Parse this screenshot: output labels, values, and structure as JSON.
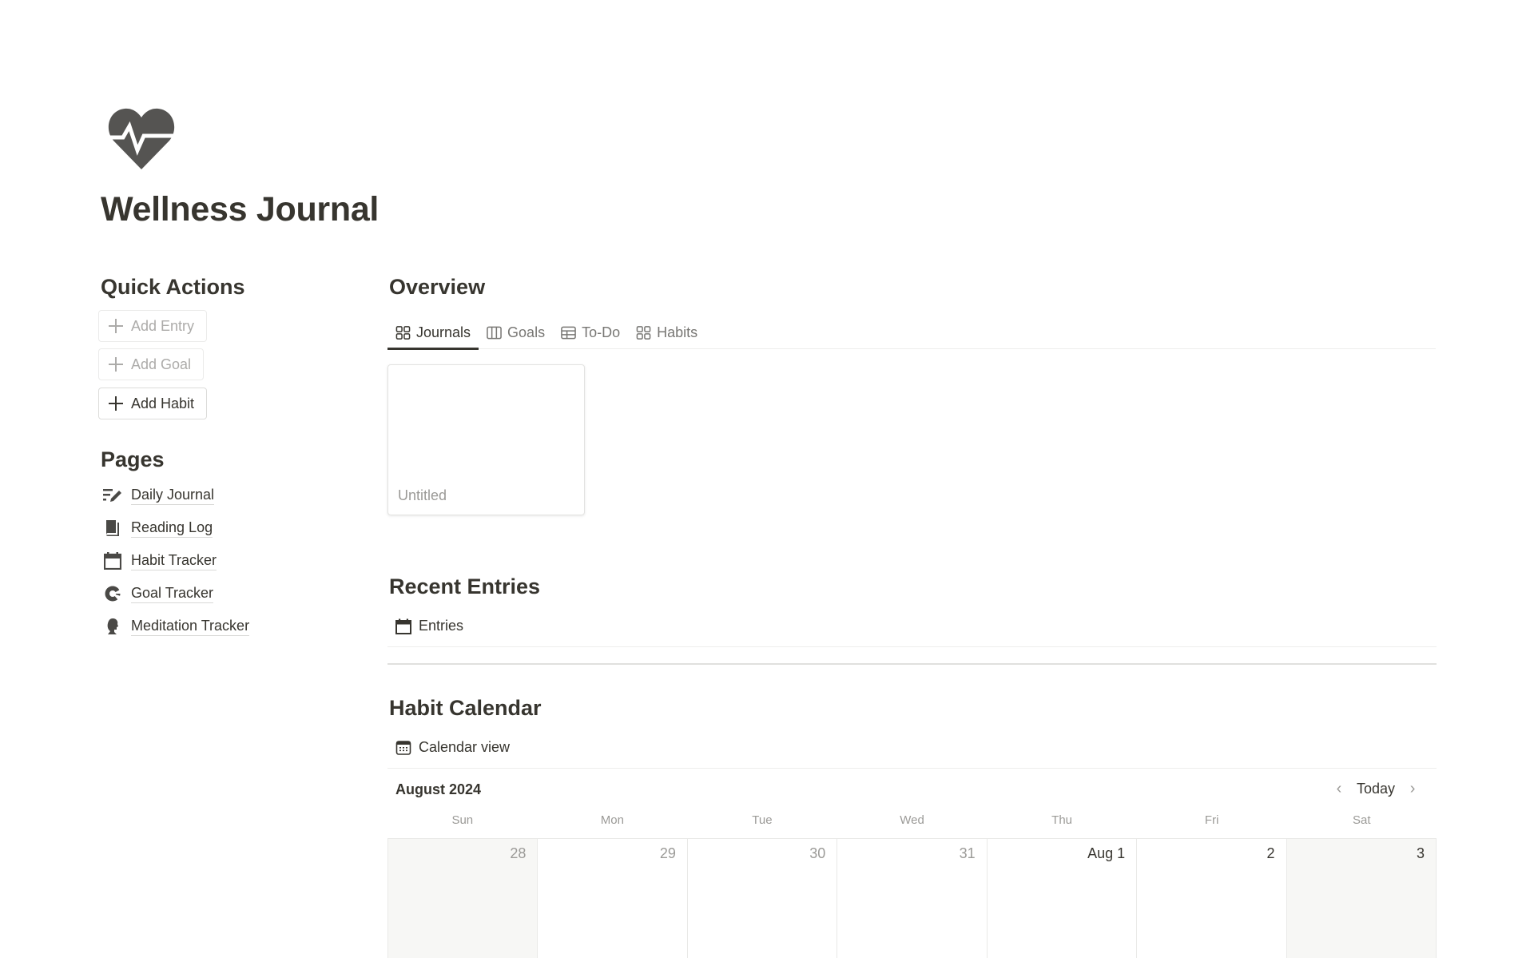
{
  "page": {
    "icon": "heart-pulse-icon",
    "title": "Wellness Journal"
  },
  "quick_actions": {
    "heading": "Quick Actions",
    "buttons": [
      {
        "label": "Add Entry",
        "icon": "plus-icon",
        "state": "muted"
      },
      {
        "label": "Add Goal",
        "icon": "plus-icon",
        "state": "muted"
      },
      {
        "label": "Add Habit",
        "icon": "plus-icon",
        "state": "active"
      }
    ]
  },
  "pages": {
    "heading": "Pages",
    "items": [
      {
        "label": "Daily Journal",
        "icon": "edit-list-icon"
      },
      {
        "label": "Reading Log",
        "icon": "book-icon"
      },
      {
        "label": "Habit Tracker",
        "icon": "calendar-icon"
      },
      {
        "label": "Goal Tracker",
        "icon": "pie-chart-icon"
      },
      {
        "label": "Meditation Tracker",
        "icon": "head-silhouette-icon"
      }
    ]
  },
  "overview": {
    "heading": "Overview",
    "tabs": [
      {
        "label": "Journals",
        "icon": "gallery-icon",
        "active": true
      },
      {
        "label": "Goals",
        "icon": "board-icon",
        "active": false
      },
      {
        "label": "To-Do",
        "icon": "table-icon",
        "active": false
      },
      {
        "label": "Habits",
        "icon": "gallery-icon",
        "active": false
      }
    ],
    "cards": [
      {
        "title": "Untitled"
      }
    ]
  },
  "recent_entries": {
    "heading": "Recent Entries",
    "view_label": "Entries",
    "view_icon": "calendar-icon"
  },
  "habit_calendar": {
    "heading": "Habit Calendar",
    "view_label": "Calendar view",
    "view_icon": "calendar-grid-icon",
    "month_label": "August 2024",
    "nav": {
      "prev": "‹",
      "today": "Today",
      "next": "›"
    },
    "weekdays": [
      "Sun",
      "Mon",
      "Tue",
      "Wed",
      "Thu",
      "Fri",
      "Sat"
    ],
    "days": [
      {
        "label": "28",
        "current_month": false,
        "weekend": true
      },
      {
        "label": "29",
        "current_month": false,
        "weekend": false
      },
      {
        "label": "30",
        "current_month": false,
        "weekend": false
      },
      {
        "label": "31",
        "current_month": false,
        "weekend": false
      },
      {
        "label": "Aug 1",
        "current_month": true,
        "weekend": false
      },
      {
        "label": "2",
        "current_month": true,
        "weekend": false
      },
      {
        "label": "3",
        "current_month": true,
        "weekend": true
      }
    ]
  }
}
